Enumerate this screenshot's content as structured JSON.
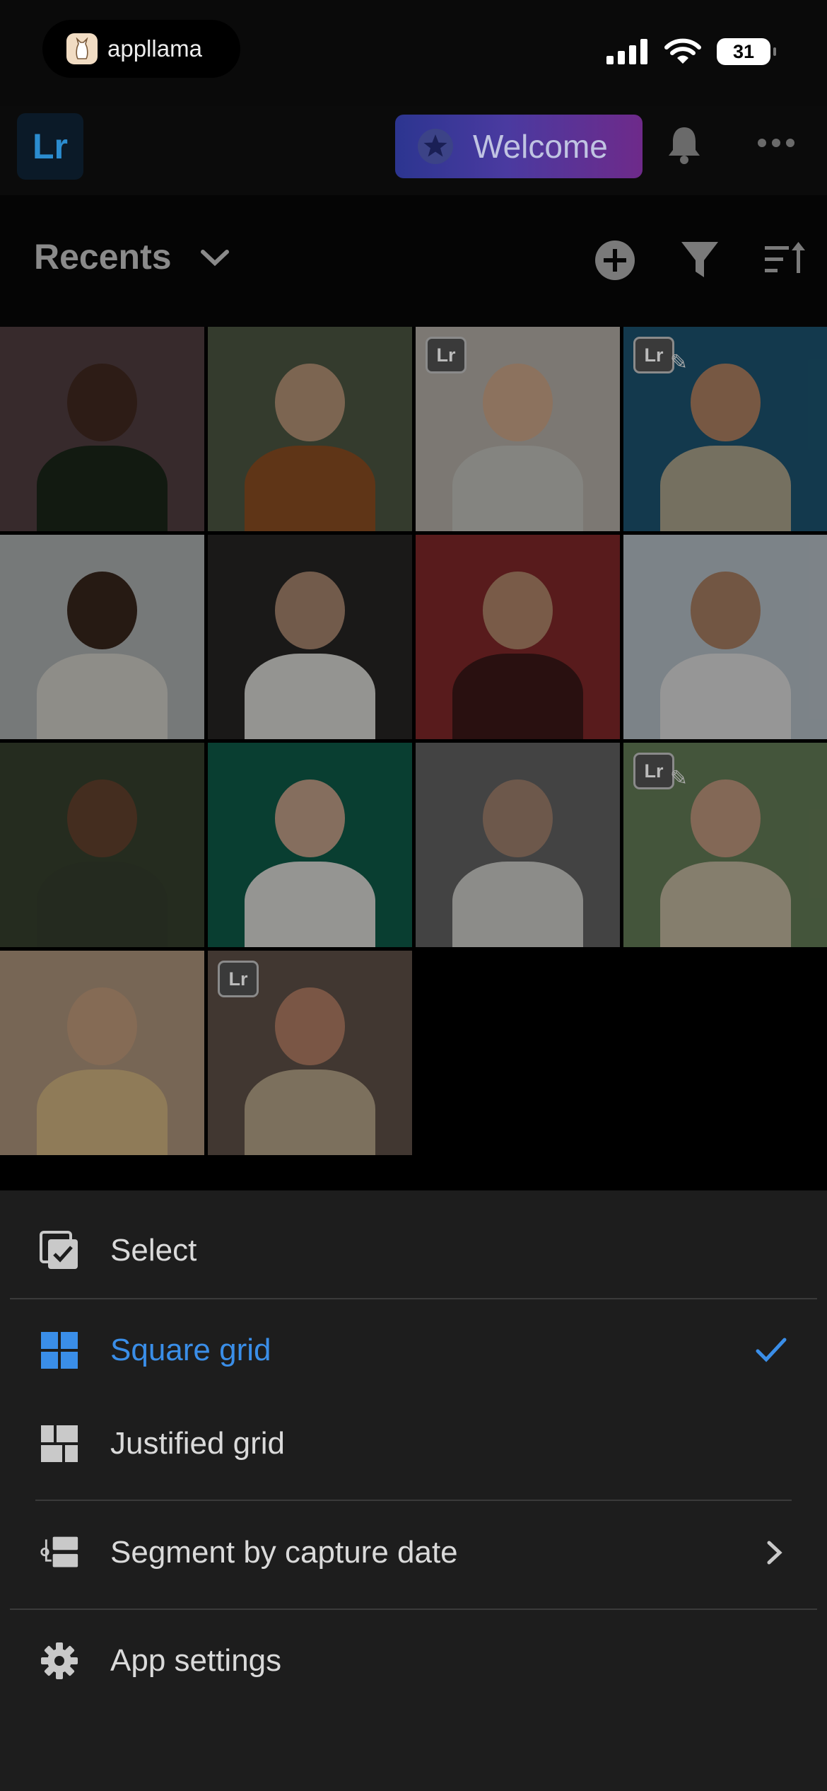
{
  "status_bar": {
    "pill_app_name": "appllama",
    "battery": "31"
  },
  "header": {
    "logo": "Lr",
    "welcome_label": "Welcome"
  },
  "toolbar": {
    "title": "Recents"
  },
  "grid": {
    "photos": [
      {
        "bg": "#5a4448",
        "skin": "#4a2e24",
        "cloth": "#1d2a1c",
        "badge": ""
      },
      {
        "bg": "#54604a",
        "skin": "#c9a484",
        "cloth": "#9a5626",
        "badge": ""
      },
      {
        "bg": "#c8c2ba",
        "skin": "#e2b898",
        "cloth": "#d5d5cf",
        "badge": "Lr"
      },
      {
        "bg": "#1f5d7c",
        "skin": "#c08f6c",
        "cloth": "#bdb59b",
        "badge": "Lr",
        "edited": true
      },
      {
        "bg": "#bfc3c3",
        "skin": "#3e2a20",
        "cloth": "#e6e4dc",
        "badge": ""
      },
      {
        "bg": "#2b2928",
        "skin": "#b9937a",
        "cloth": "#efefea",
        "badge": ""
      },
      {
        "bg": "#8f2d2e",
        "skin": "#c39474",
        "cloth": "#431a1a",
        "badge": ""
      },
      {
        "bg": "#c9d3dc",
        "skin": "#b98c6c",
        "cloth": "#f2f2f2",
        "badge": ""
      },
      {
        "bg": "#3d4832",
        "skin": "#6f4a32",
        "cloth": "#3a4532",
        "badge": ""
      },
      {
        "bg": "#0f6450",
        "skin": "#d7b298",
        "cloth": "#f0f0ec",
        "badge": ""
      },
      {
        "bg": "#6d6d6d",
        "skin": "#b08f7a",
        "cloth": "#e2e2de",
        "badge": ""
      },
      {
        "bg": "#6f8960",
        "skin": "#d4a88c",
        "cloth": "#d7cbb1",
        "badge": "Lr",
        "edited": true
      },
      {
        "bg": "#c1a589",
        "skin": "#d7ad8a",
        "cloth": "#e7c78f",
        "badge": ""
      },
      {
        "bg": "#6a5a4f",
        "skin": "#c58c70",
        "cloth": "#c9b596",
        "badge": "Lr"
      }
    ]
  },
  "menu": {
    "select": "Select",
    "square_grid": "Square grid",
    "justified_grid": "Justified grid",
    "segment": "Segment by capture date",
    "settings": "App settings"
  },
  "colors": {
    "accent": "#3a8ee8",
    "sheet": "#1d1d1d"
  }
}
